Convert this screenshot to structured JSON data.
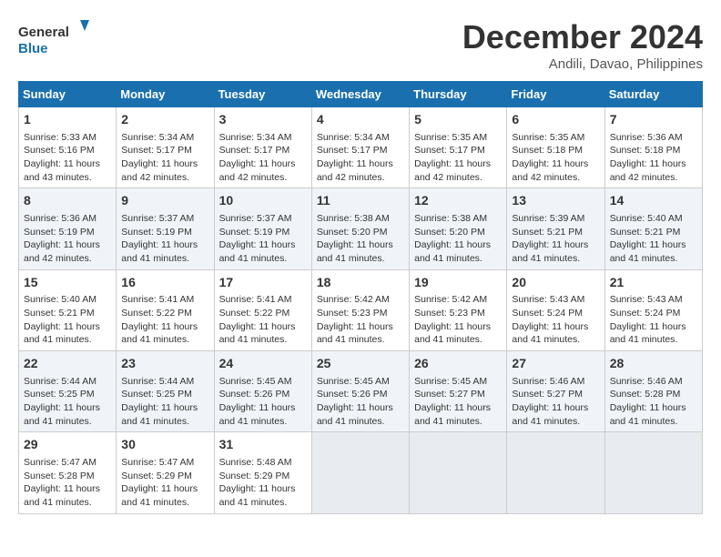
{
  "logo": {
    "line1": "General",
    "line2": "Blue"
  },
  "title": {
    "month_year": "December 2024",
    "location": "Andili, Davao, Philippines"
  },
  "headers": [
    "Sunday",
    "Monday",
    "Tuesday",
    "Wednesday",
    "Thursday",
    "Friday",
    "Saturday"
  ],
  "weeks": [
    [
      {
        "day": "1",
        "info": "Sunrise: 5:33 AM\nSunset: 5:16 PM\nDaylight: 11 hours\nand 43 minutes."
      },
      {
        "day": "2",
        "info": "Sunrise: 5:34 AM\nSunset: 5:17 PM\nDaylight: 11 hours\nand 42 minutes."
      },
      {
        "day": "3",
        "info": "Sunrise: 5:34 AM\nSunset: 5:17 PM\nDaylight: 11 hours\nand 42 minutes."
      },
      {
        "day": "4",
        "info": "Sunrise: 5:34 AM\nSunset: 5:17 PM\nDaylight: 11 hours\nand 42 minutes."
      },
      {
        "day": "5",
        "info": "Sunrise: 5:35 AM\nSunset: 5:17 PM\nDaylight: 11 hours\nand 42 minutes."
      },
      {
        "day": "6",
        "info": "Sunrise: 5:35 AM\nSunset: 5:18 PM\nDaylight: 11 hours\nand 42 minutes."
      },
      {
        "day": "7",
        "info": "Sunrise: 5:36 AM\nSunset: 5:18 PM\nDaylight: 11 hours\nand 42 minutes."
      }
    ],
    [
      {
        "day": "8",
        "info": "Sunrise: 5:36 AM\nSunset: 5:19 PM\nDaylight: 11 hours\nand 42 minutes."
      },
      {
        "day": "9",
        "info": "Sunrise: 5:37 AM\nSunset: 5:19 PM\nDaylight: 11 hours\nand 41 minutes."
      },
      {
        "day": "10",
        "info": "Sunrise: 5:37 AM\nSunset: 5:19 PM\nDaylight: 11 hours\nand 41 minutes."
      },
      {
        "day": "11",
        "info": "Sunrise: 5:38 AM\nSunset: 5:20 PM\nDaylight: 11 hours\nand 41 minutes."
      },
      {
        "day": "12",
        "info": "Sunrise: 5:38 AM\nSunset: 5:20 PM\nDaylight: 11 hours\nand 41 minutes."
      },
      {
        "day": "13",
        "info": "Sunrise: 5:39 AM\nSunset: 5:21 PM\nDaylight: 11 hours\nand 41 minutes."
      },
      {
        "day": "14",
        "info": "Sunrise: 5:40 AM\nSunset: 5:21 PM\nDaylight: 11 hours\nand 41 minutes."
      }
    ],
    [
      {
        "day": "15",
        "info": "Sunrise: 5:40 AM\nSunset: 5:21 PM\nDaylight: 11 hours\nand 41 minutes."
      },
      {
        "day": "16",
        "info": "Sunrise: 5:41 AM\nSunset: 5:22 PM\nDaylight: 11 hours\nand 41 minutes."
      },
      {
        "day": "17",
        "info": "Sunrise: 5:41 AM\nSunset: 5:22 PM\nDaylight: 11 hours\nand 41 minutes."
      },
      {
        "day": "18",
        "info": "Sunrise: 5:42 AM\nSunset: 5:23 PM\nDaylight: 11 hours\nand 41 minutes."
      },
      {
        "day": "19",
        "info": "Sunrise: 5:42 AM\nSunset: 5:23 PM\nDaylight: 11 hours\nand 41 minutes."
      },
      {
        "day": "20",
        "info": "Sunrise: 5:43 AM\nSunset: 5:24 PM\nDaylight: 11 hours\nand 41 minutes."
      },
      {
        "day": "21",
        "info": "Sunrise: 5:43 AM\nSunset: 5:24 PM\nDaylight: 11 hours\nand 41 minutes."
      }
    ],
    [
      {
        "day": "22",
        "info": "Sunrise: 5:44 AM\nSunset: 5:25 PM\nDaylight: 11 hours\nand 41 minutes."
      },
      {
        "day": "23",
        "info": "Sunrise: 5:44 AM\nSunset: 5:25 PM\nDaylight: 11 hours\nand 41 minutes."
      },
      {
        "day": "24",
        "info": "Sunrise: 5:45 AM\nSunset: 5:26 PM\nDaylight: 11 hours\nand 41 minutes."
      },
      {
        "day": "25",
        "info": "Sunrise: 5:45 AM\nSunset: 5:26 PM\nDaylight: 11 hours\nand 41 minutes."
      },
      {
        "day": "26",
        "info": "Sunrise: 5:45 AM\nSunset: 5:27 PM\nDaylight: 11 hours\nand 41 minutes."
      },
      {
        "day": "27",
        "info": "Sunrise: 5:46 AM\nSunset: 5:27 PM\nDaylight: 11 hours\nand 41 minutes."
      },
      {
        "day": "28",
        "info": "Sunrise: 5:46 AM\nSunset: 5:28 PM\nDaylight: 11 hours\nand 41 minutes."
      }
    ],
    [
      {
        "day": "29",
        "info": "Sunrise: 5:47 AM\nSunset: 5:28 PM\nDaylight: 11 hours\nand 41 minutes."
      },
      {
        "day": "30",
        "info": "Sunrise: 5:47 AM\nSunset: 5:29 PM\nDaylight: 11 hours\nand 41 minutes."
      },
      {
        "day": "31",
        "info": "Sunrise: 5:48 AM\nSunset: 5:29 PM\nDaylight: 11 hours\nand 41 minutes."
      },
      {
        "day": "",
        "info": ""
      },
      {
        "day": "",
        "info": ""
      },
      {
        "day": "",
        "info": ""
      },
      {
        "day": "",
        "info": ""
      }
    ]
  ]
}
